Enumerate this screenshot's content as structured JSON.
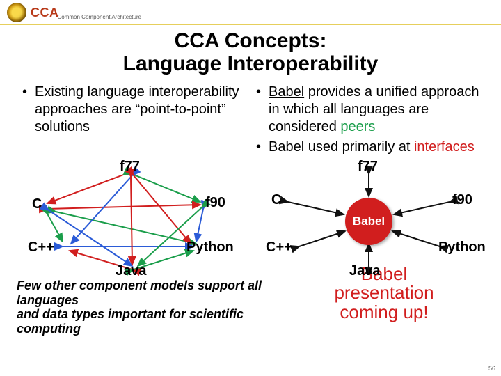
{
  "header": {
    "logo_text": "CCA",
    "subtitle": "Common Component Architecture"
  },
  "title_l1": "CCA Concepts:",
  "title_l2": "Language Interoperability",
  "left_bullets": [
    "Existing language interoperability approaches are “point-to-point” solutions"
  ],
  "right_bullets": [
    {
      "pre": "",
      "u": "Babel",
      "mid": " provides a unified approach in which all languages are considered ",
      "peers": "peers",
      "post": ""
    },
    {
      "pre": "Babel used primarily at ",
      "iface": "interfaces",
      "post": ""
    }
  ],
  "langs": {
    "f77": "f77",
    "c": "C",
    "f90": "f90",
    "cpp": "C++",
    "python": "Python",
    "java": "Java"
  },
  "babel_label": "Babel",
  "footnote_l1": "Few other component models support all languages",
  "footnote_l2": "and data types important for scientific computing",
  "callout_l1": "Babel",
  "callout_l2": "presentation",
  "callout_l3": "coming up!",
  "slide_number": "56"
}
